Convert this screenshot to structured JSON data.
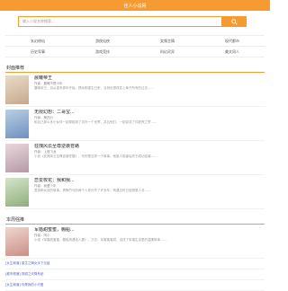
{
  "header": {
    "title": "佳人小说网"
  },
  "search": {
    "placeholder": "输入小说名称搜索..."
  },
  "nav": {
    "row1": [
      "玄幻修仙",
      "游侠仙侠",
      "女频言情",
      "现代都市"
    ],
    "row2": [
      "历史军事",
      "游戏竞技",
      "科幻灵异",
      "美文同人"
    ]
  },
  "sections": {
    "hot": "封面推荐",
    "recommend": "本周强推"
  },
  "books": [
    {
      "title": "晨曦帝王",
      "author": "作者：晨曦不是小年",
      "desc": "晨曦帝王，自从重来那年开始，顾永刚重生归来，当然也想改变上辈子所有的过去……",
      "color1": "#e8dcc8",
      "color2": "#c8a88c"
    },
    {
      "title": "无限幻想：二哥宝...",
      "author": "作者：鹿四分",
      "desc": "和自己那么多小伙伴一起穿越到了另外一个世界，并且他们，一起变成了仲夏夜之梦……",
      "color1": "#b8cfe3",
      "color2": "#6f8fbf"
    },
    {
      "title": "狂拽风云至尊逆袭苍路",
      "author": "作者：上首飞龙",
      "desc": "小说《狂拽风云至尊逆袭苍路》，写的是这样一个故事，他被人陷害后终于成功逆袭……",
      "color1": "#e9d7dc",
      "color2": "#b49aa6"
    },
    {
      "title": "恋爱校花：我和我...",
      "author": "作者：我爱少年",
      "desc": "男孩和女孩的故事，青梅竹马的两个人却分开了许多年，再遇见时已经物是人非……",
      "color1": "#d5e4c9",
      "color2": "#8fae7c"
    }
  ],
  "featured": {
    "title": "军婚甜蜜蜜，棚船...",
    "author": "作者：阿小",
    "desc": "小说《军婚甜蜜蜜，棚船再遇佳人要》，又名：军婚蜜蜜甜，讲述了军婚生活里的温暖故事……",
    "color1": "#f0d6cf",
    "color2": "#c98f86"
  },
  "list": [
    "[女生频道] 重生之嫡女手下无敌",
    "[都市频道] 穿越之天降系统",
    "[女生频道] 你是我的小可爱"
  ],
  "colors": {
    "accent": "#f59b31",
    "link": "#5b6ac8"
  }
}
